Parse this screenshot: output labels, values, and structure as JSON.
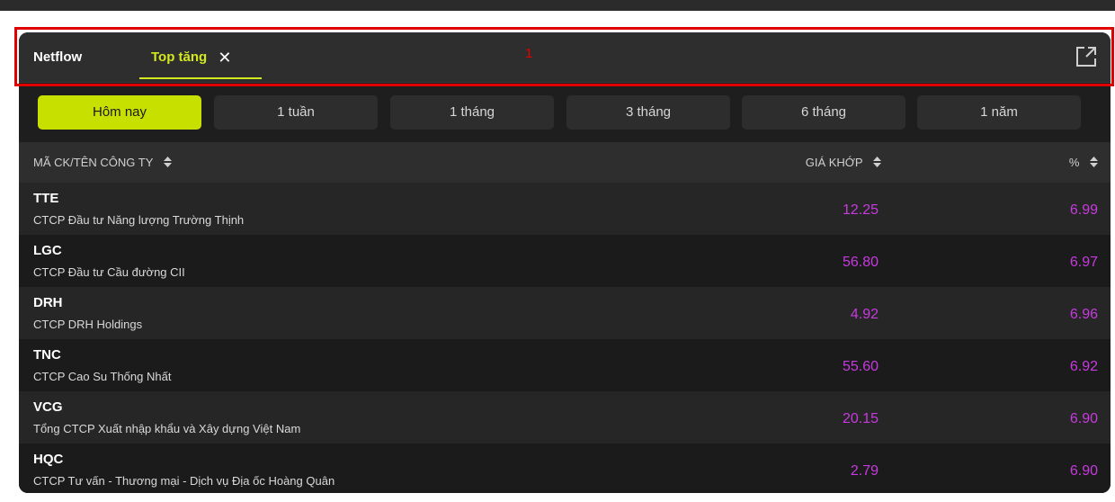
{
  "tabs": {
    "netflow_label": "Netflow",
    "top_label": "Top tăng",
    "close_glyph": "✕"
  },
  "annotation": {
    "number": "1"
  },
  "periods": [
    "Hôm nay",
    "1 tuần",
    "1 tháng",
    "3 tháng",
    "6 tháng",
    "1 năm"
  ],
  "active_period": "Hôm nay",
  "table": {
    "headers": {
      "name": "MÃ CK/TÊN CÔNG TY",
      "price": "GIÁ KHỚP",
      "pct": "%"
    },
    "rows": [
      {
        "symbol": "TTE",
        "company": "CTCP Đầu tư Năng lượng Trường Thịnh",
        "price": "12.25",
        "pct": "6.99"
      },
      {
        "symbol": "LGC",
        "company": "CTCP Đầu tư Cầu đường CII",
        "price": "56.80",
        "pct": "6.97"
      },
      {
        "symbol": "DRH",
        "company": "CTCP DRH Holdings",
        "price": "4.92",
        "pct": "6.96"
      },
      {
        "symbol": "TNC",
        "company": "CTCP Cao Su Thống Nhất",
        "price": "55.60",
        "pct": "6.92"
      },
      {
        "symbol": "VCG",
        "company": "Tổng CTCP Xuất nhập khẩu và Xây dựng Việt Nam",
        "price": "20.15",
        "pct": "6.90"
      },
      {
        "symbol": "HQC",
        "company": "CTCP Tư vấn - Thương mại - Dịch vụ Địa ốc Hoàng Quân",
        "price": "2.79",
        "pct": "6.90"
      }
    ]
  },
  "colors": {
    "accent": "#d4e81f",
    "price_up": "#c83ae0",
    "annotation": "#e00000"
  }
}
